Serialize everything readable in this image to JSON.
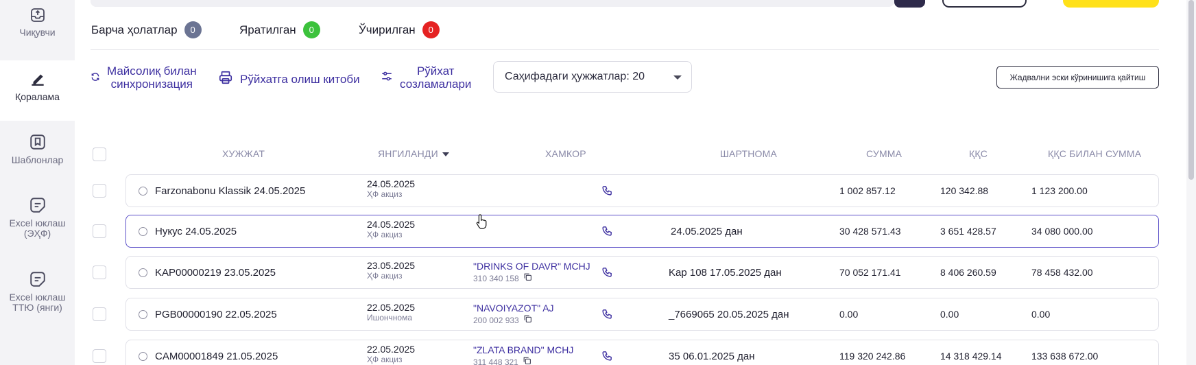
{
  "sidebar": {
    "items": [
      {
        "label": "Чиқувчи",
        "icon": "inbox-outgoing-icon",
        "active": false
      },
      {
        "label": "Қоралама",
        "icon": "pencil-draft-icon",
        "active": true
      },
      {
        "label": "Шаблонлар",
        "icon": "bookmark-template-icon",
        "active": false
      },
      {
        "label": "Excel юклаш\n(ЭҲФ)",
        "icon": "excel-upload-icon",
        "active": false
      },
      {
        "label": "Excel юклаш\nТТЮ (янги)",
        "icon": "excel-upload-icon",
        "active": false
      }
    ]
  },
  "status_tabs": [
    {
      "label": "Барча ҳолатлар",
      "count": "0",
      "color": "#6b7493"
    },
    {
      "label": "Яратилган",
      "count": "0",
      "color": "#3cc23c"
    },
    {
      "label": "Ўчирилган",
      "count": "0",
      "color": "#e52222"
    }
  ],
  "toolbar": {
    "sync_label": "Майсолиқ билан\nсинхронизация",
    "print_label": "Рўйхатга олиш китоби",
    "settings_label": "Рўйхат\nсозламалари",
    "page_size_label": "Саҳифадаги ҳужжатлар: 20",
    "old_view_label": "Жадвални эски кўринишига қайтиш"
  },
  "table": {
    "headers": {
      "document": "ХУЖЖАТ",
      "updated": "ЯНГИЛАНДИ",
      "partner": "ХАМКОР",
      "contract": "ШАРТНОМА",
      "sum": "СУММА",
      "vat": "ҚҚС",
      "total": "ҚҚС БИЛАН СУММА"
    },
    "rows": [
      {
        "document": "Farzonabonu Klassik  24.05.2025",
        "updated_date": "24.05.2025",
        "updated_type": "ҲФ акциз",
        "partner_name": "",
        "partner_inn": "",
        "contract": "",
        "sum": "1 002 857.12",
        "vat": "120 342.88",
        "total": "1 123 200.00",
        "selected": false
      },
      {
        "document": "Нукус  24.05.2025",
        "updated_date": "24.05.2025",
        "updated_type": "ҲФ акциз",
        "partner_name": "",
        "partner_inn": "",
        "contract": "24.05.2025 дан",
        "sum": "30 428 571.43",
        "vat": "3 651 428.57",
        "total": "34 080 000.00",
        "selected": true
      },
      {
        "document": "KAP00000219  23.05.2025",
        "updated_date": "23.05.2025",
        "updated_type": "ҲФ акциз",
        "partner_name": "\"DRINKS OF DAVR\" MCHJ",
        "partner_inn": "310 340 158",
        "contract": "Kap 108  17.05.2025 дан",
        "sum": "70 052 171.41",
        "vat": "8 406 260.59",
        "total": "78 458 432.00",
        "selected": false
      },
      {
        "document": "PGB00000190  22.05.2025",
        "updated_date": "22.05.2025",
        "updated_type": "Ишончнома",
        "partner_name": "\"NAVOIYAZOT\" AJ",
        "partner_inn": "200 002 933",
        "contract": "_7669065  20.05.2025 дан",
        "sum": "0.00",
        "vat": "0.00",
        "total": "0.00",
        "selected": false
      },
      {
        "document": "CAM00001849  21.05.2025",
        "updated_date": "22.05.2025",
        "updated_type": "ҲФ акциз",
        "partner_name": "\"ZLATA BRAND\" MCHJ",
        "partner_inn": "311 448 321",
        "contract": "35  06.01.2025 дан",
        "sum": "119 320 242.86",
        "vat": "14 318 429.14",
        "total": "133 638 672.00",
        "selected": false
      }
    ]
  },
  "colors": {
    "accent": "#3d2fa0",
    "selected_border": "#5a4fc8",
    "brand_yellow": "#ffe11a"
  }
}
